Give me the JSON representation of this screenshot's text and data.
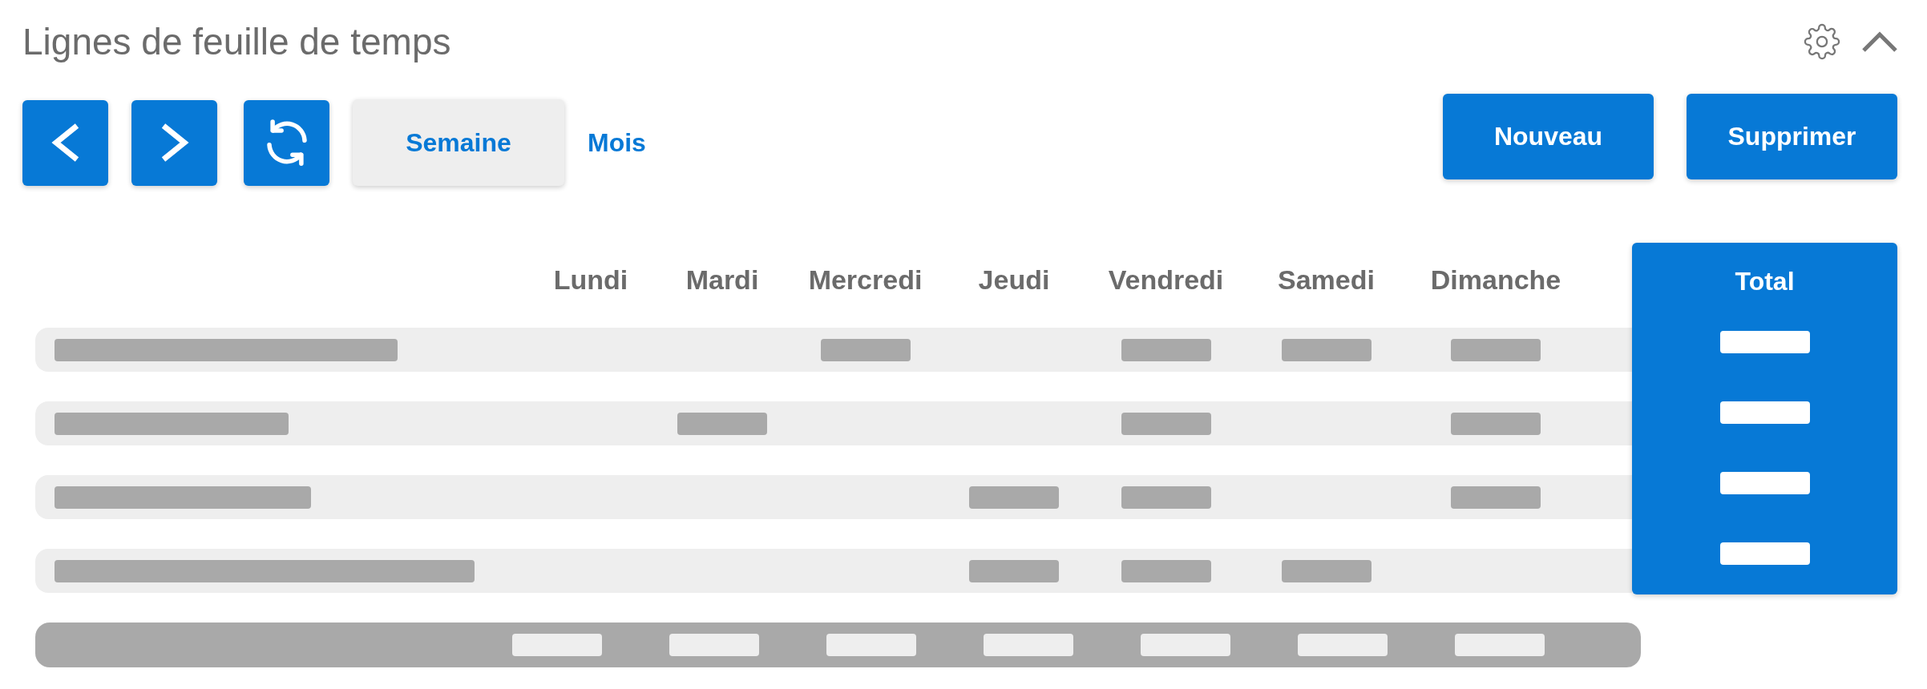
{
  "title": "Lignes de feuille de temps",
  "view_tabs": [
    {
      "label": "Semaine",
      "selected": true
    },
    {
      "label": "Mois",
      "selected": false
    }
  ],
  "actions": [
    "Nouveau",
    "Supprimer"
  ],
  "days": [
    "Lundi",
    "Mardi",
    "Mercredi",
    "Jeudi",
    "Vendredi",
    "Samedi",
    "Dimanche"
  ],
  "total_label": "Total",
  "rows": [
    {
      "filled": [
        false,
        false,
        true,
        false,
        true,
        true,
        true
      ]
    },
    {
      "filled": [
        false,
        true,
        false,
        false,
        true,
        false,
        true
      ]
    },
    {
      "filled": [
        false,
        false,
        false,
        true,
        true,
        false,
        true
      ]
    },
    {
      "filled": [
        false,
        false,
        false,
        true,
        true,
        true,
        false
      ]
    }
  ]
}
